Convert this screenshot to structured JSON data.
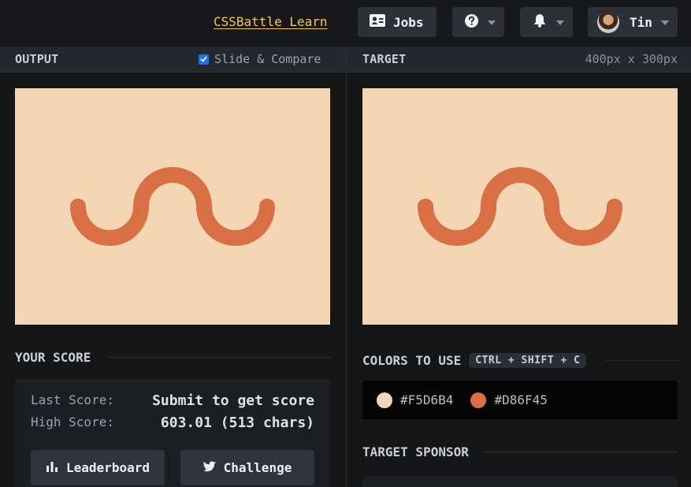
{
  "topbar": {
    "learn_link": "CSSBattle Learn",
    "jobs_label": "Jobs",
    "user_name": "Tin",
    "icons": [
      "id-card-icon",
      "question-circle-icon",
      "bell-icon",
      "avatar"
    ]
  },
  "output_panel": {
    "title": "OUTPUT",
    "slide_compare_label": "Slide & Compare",
    "slide_compare_checked": true
  },
  "target_panel": {
    "title": "TARGET",
    "dimensions": "400px x 300px"
  },
  "canvas": {
    "background": "#F5D6B4",
    "shape_color": "#D86F45"
  },
  "score": {
    "section_title": "YOUR SCORE",
    "last_score_label": "Last Score:",
    "last_score_value": "Submit to get score",
    "high_score_label": "High Score:",
    "high_score_value": "603.01 (513 chars)",
    "leaderboard_label": "Leaderboard",
    "challenge_label": "Challenge"
  },
  "colors": {
    "section_title": "COLORS TO USE",
    "shortcut": "CTRL + SHIFT + C",
    "swatches": [
      {
        "hex": "#F5D6B4",
        "label": "#F5D6B4"
      },
      {
        "hex": "#D86F45",
        "label": "#D86F45"
      }
    ]
  },
  "sponsor": {
    "section_title": "TARGET SPONSOR"
  }
}
